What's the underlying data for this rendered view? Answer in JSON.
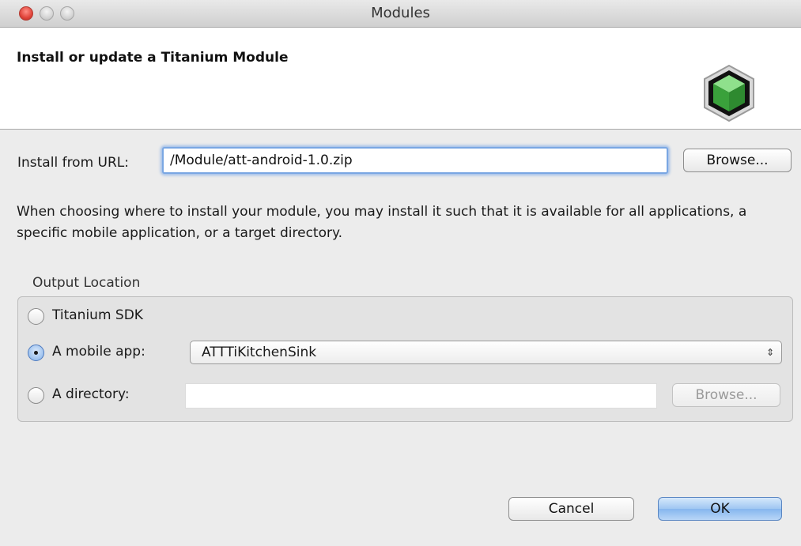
{
  "window": {
    "title": "Modules"
  },
  "header": {
    "title": "Install or update a Titanium Module"
  },
  "url_row": {
    "label": "Install from URL:",
    "value": "/Module/att-android-1.0.zip",
    "browse_label": "Browse..."
  },
  "info_text": "When choosing where to install your module, you may install it such that it is available for all applications, a specific mobile application, or a target directory.",
  "output_location": {
    "label": "Output Location",
    "options": [
      {
        "label": "Titanium SDK",
        "checked": false
      },
      {
        "label": "A mobile app:",
        "checked": true
      },
      {
        "label": "A directory:",
        "checked": false
      }
    ],
    "mobile_app_selected": "ATTTiKitchenSink",
    "directory_value": "",
    "directory_browse_label": "Browse..."
  },
  "footer": {
    "cancel_label": "Cancel",
    "ok_label": "OK"
  },
  "colors": {
    "focus_ring": "#7aa7e3",
    "ok_button": "#9fc6f2",
    "close_button": "#e0443a",
    "icon_green": "#4caf50"
  }
}
